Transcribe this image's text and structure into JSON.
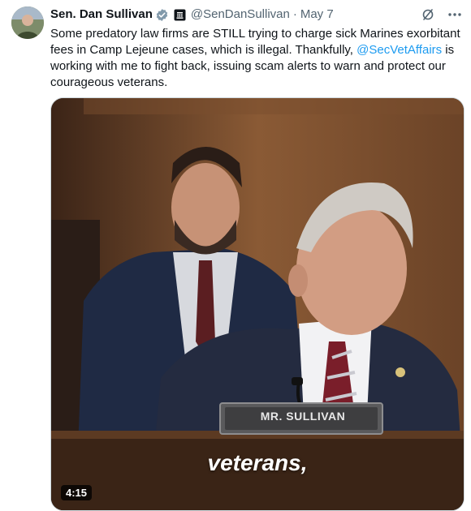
{
  "tweet": {
    "author_name": "Sen. Dan Sullivan",
    "handle": "@SenDanSullivan",
    "separator": "·",
    "date": "May 7",
    "text_1": "Some predatory law firms are STILL trying to charge sick Marines exorbitant fees in Camp Lejeune cases, which is illegal. Thankfully, ",
    "mention": "@SecVetAffairs",
    "text_2": " is working with me to fight back, issuing scam alerts to warn and protect our courageous veterans.",
    "icons": {
      "verified": "verified-badge-icon",
      "government": "government-affiliation-icon",
      "grok": "grok-icon",
      "more": "more-options-icon"
    }
  },
  "video": {
    "caption": "veterans,",
    "nameplate": "MR. SULLIVAN",
    "duration": "4:15"
  },
  "colors": {
    "link": "#1d9bf0",
    "secondary_text": "#536471",
    "verified": "#829aab"
  }
}
